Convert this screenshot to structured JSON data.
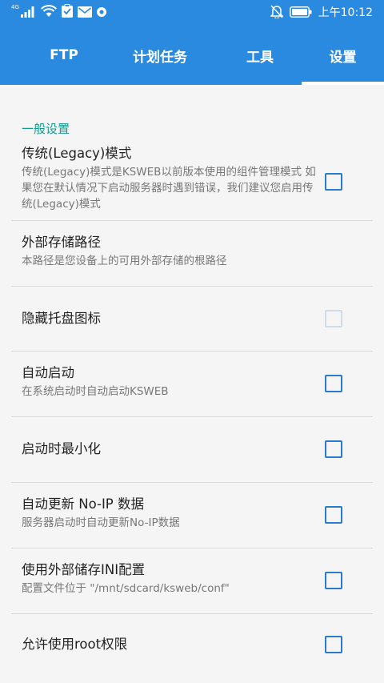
{
  "status_bar": {
    "network_label": "4G",
    "time": "上午10:12",
    "icons": [
      "signal-icon",
      "wifi-icon",
      "clipboard-icon",
      "mail-icon",
      "notification-dot-icon",
      "mute-icon",
      "battery-icon"
    ]
  },
  "tabs": [
    {
      "label": "FTP",
      "active": false
    },
    {
      "label": "计划任务",
      "active": false
    },
    {
      "label": "工具",
      "active": false
    },
    {
      "label": "设置",
      "active": true
    }
  ],
  "section": {
    "title": "一般设置"
  },
  "settings": [
    {
      "title": "传统(Legacy)模式",
      "subtitle": "传统(Legacy)模式是KSWEB以前版本使用的组件管理模式 如果您在默认情况下启动服务器时遇到错误，我们建议您启用传统(Legacy)模式",
      "has_checkbox": true,
      "checked": false,
      "enabled": true
    },
    {
      "title": "外部存储路径",
      "subtitle": "本路径是您设备上的可用外部存储的根路径",
      "has_checkbox": false
    },
    {
      "title": "隐藏托盘图标",
      "subtitle": "",
      "has_checkbox": true,
      "checked": false,
      "enabled": false
    },
    {
      "title": "自动启动",
      "subtitle": "在系统启动时自动启动KSWEB",
      "has_checkbox": true,
      "checked": false,
      "enabled": true
    },
    {
      "title": "启动时最小化",
      "subtitle": "",
      "has_checkbox": true,
      "checked": false,
      "enabled": true
    },
    {
      "title": "自动更新 No-IP 数据",
      "subtitle": "服务器启动时自动更新No-IP数据",
      "has_checkbox": true,
      "checked": false,
      "enabled": true
    },
    {
      "title": "使用外部储存INI配置",
      "subtitle": "配置文件位于 \"/mnt/sdcard/ksweb/conf\"",
      "has_checkbox": true,
      "checked": false,
      "enabled": true
    },
    {
      "title": "允许使用root权限",
      "subtitle": "",
      "has_checkbox": true,
      "checked": false,
      "enabled": true
    }
  ],
  "colors": {
    "primary": "#2a8ae0",
    "accent_text": "#1a9a8a",
    "checkbox": "#2a7ad0",
    "checkbox_disabled": "#cfdbe6"
  }
}
